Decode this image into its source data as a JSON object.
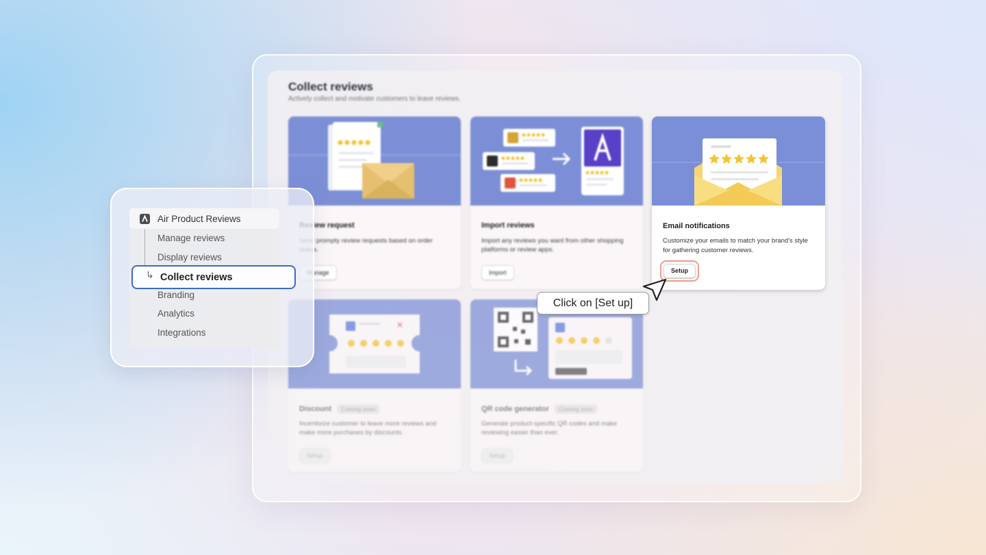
{
  "main": {
    "title": "Collect reviews",
    "subtitle": "Actively collect and motivate customers to leave reviews."
  },
  "cards": [
    {
      "title": "Review request",
      "description": "Send prompty review requests based on order status.",
      "button": "Manage"
    },
    {
      "title": "Import reviews",
      "description": "Import any reviews you want from other shopping platforms or review apps.",
      "button": "Import"
    },
    {
      "title": "Email notifications",
      "description": "Customize your emails to match your brand's style for gathering customer reviews.",
      "button": "Setup"
    },
    {
      "title": "Discount",
      "badge": "Coming soon",
      "description": "Incentivize customer to leave more reviews and make more purchases by discounts.",
      "button": "Setup"
    },
    {
      "title": "QR code generator",
      "badge": "Coming soon",
      "description": "Generate product-specific QR codes and make reviewing easier than ever.",
      "button": "Setup"
    }
  ],
  "sidebar": {
    "app_name": "Air Product Reviews",
    "items": [
      "Manage reviews",
      "Display reviews",
      "Collect reviews",
      "Branding",
      "Analytics",
      "Integrations"
    ],
    "active_item": "Collect reviews",
    "tree_arrow": "↳"
  },
  "tooltip": {
    "text": "Click on [Set up]"
  },
  "colors": {
    "hero_blue": "#7c8fd6",
    "star_yellow": "#f4c430",
    "highlight_ring": "#f2988b",
    "active_border": "#3e6ac2"
  }
}
